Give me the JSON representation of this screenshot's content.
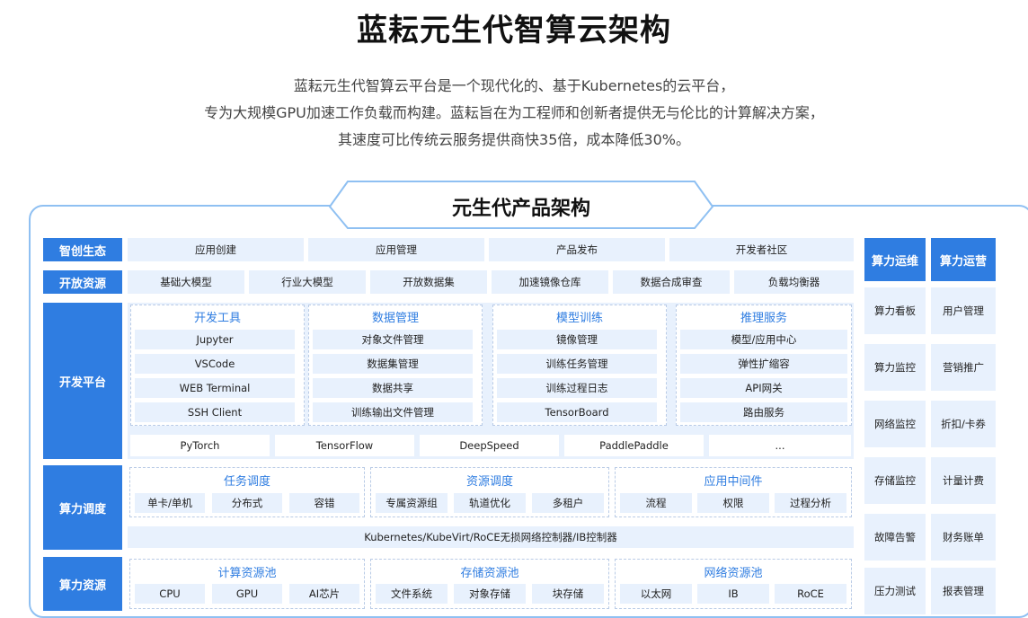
{
  "title": "蓝耘元生代智算云架构",
  "description": [
    "蓝耘元生代智算云平台是一个现代化的、基于Kubernetes的云平台，",
    "专为大规模GPU加速工作负载而构建。蓝耘旨在为工程师和创新者提供无与伦比的计算解决方案，",
    "其速度可比传统云服务提供商快35倍，成本降低30%。"
  ],
  "diagram": {
    "header": "元生代产品架构",
    "rows": {
      "ecosystem": {
        "label": "智创生态",
        "items": [
          "应用创建",
          "应用管理",
          "产品发布",
          "开发者社区"
        ]
      },
      "open_resources": {
        "label": "开放资源",
        "items": [
          "基础大模型",
          "行业大模型",
          "开放数据集",
          "加速镜像仓库",
          "数据合成审查",
          "负载均衡器"
        ]
      },
      "dev_platform": {
        "label": "开发平台",
        "groups": [
          {
            "title": "开发工具",
            "items": [
              "Jupyter",
              "VSCode",
              "WEB Terminal",
              "SSH Client"
            ]
          },
          {
            "title": "数据管理",
            "items": [
              "对象文件管理",
              "数据集管理",
              "数据共享",
              "训练输出文件管理"
            ]
          },
          {
            "title": "模型训练",
            "items": [
              "镜像管理",
              "训练任务管理",
              "训练过程日志",
              "TensorBoard"
            ]
          },
          {
            "title": "推理服务",
            "items": [
              "模型/应用中心",
              "弹性扩缩容",
              "API网关",
              "路由服务"
            ]
          }
        ],
        "frameworks": [
          "PyTorch",
          "TensorFlow",
          "DeepSpeed",
          "PaddlePaddle",
          "..."
        ]
      },
      "scheduling": {
        "label": "算力调度",
        "groups": [
          {
            "title": "任务调度",
            "items": [
              "单卡/单机",
              "分布式",
              "容错"
            ]
          },
          {
            "title": "资源调度",
            "items": [
              "专属资源组",
              "轨道优化",
              "多租户"
            ]
          },
          {
            "title": "应用中间件",
            "items": [
              "流程",
              "权限",
              "过程分析"
            ]
          }
        ],
        "footer": "Kubernetes/KubeVirt/RoCE无损网络控制器/IB控制器"
      },
      "resources": {
        "label": "算力资源",
        "groups": [
          {
            "title": "计算资源池",
            "items": [
              "CPU",
              "GPU",
              "AI芯片"
            ]
          },
          {
            "title": "存储资源池",
            "items": [
              "文件系统",
              "对象存储",
              "块存储"
            ]
          },
          {
            "title": "网络资源池",
            "items": [
              "以太网",
              "IB",
              "RoCE"
            ]
          }
        ]
      }
    },
    "side": {
      "ops": {
        "label": "算力运维",
        "items": [
          "算力看板",
          "算力监控",
          "网络监控",
          "存储监控",
          "故障告警",
          "压力测试"
        ]
      },
      "operations": {
        "label": "算力运营",
        "items": [
          "用户管理",
          "营销推广",
          "折扣/卡券",
          "计量计费",
          "财务账单",
          "报表管理"
        ]
      }
    }
  },
  "colors": {
    "accent": "#2f7de1",
    "cell_bg": "#e8f1fd",
    "frame": "#8fc0f2",
    "group_title": "#2f7de1"
  }
}
